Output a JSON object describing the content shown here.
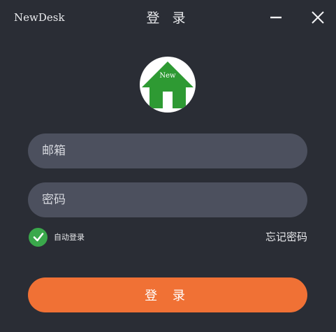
{
  "window": {
    "app_name": "NewDesk",
    "title": "登 录",
    "minimize_icon": "minimize-icon",
    "close_icon": "close-icon"
  },
  "logo": {
    "icon": "house-icon",
    "text": "New",
    "house_color": "#2e9a33"
  },
  "form": {
    "email_placeholder": "邮箱",
    "email_value": "",
    "password_placeholder": "密码",
    "password_value": "",
    "auto_login_label": "自动登录",
    "auto_login_checked": true,
    "forgot_password_label": "忘记密码",
    "login_button_label": "登 录"
  },
  "colors": {
    "background": "#2a2d35",
    "input_background": "#4c505e",
    "accent": "#f07135",
    "checkbox": "#3aa84b"
  }
}
